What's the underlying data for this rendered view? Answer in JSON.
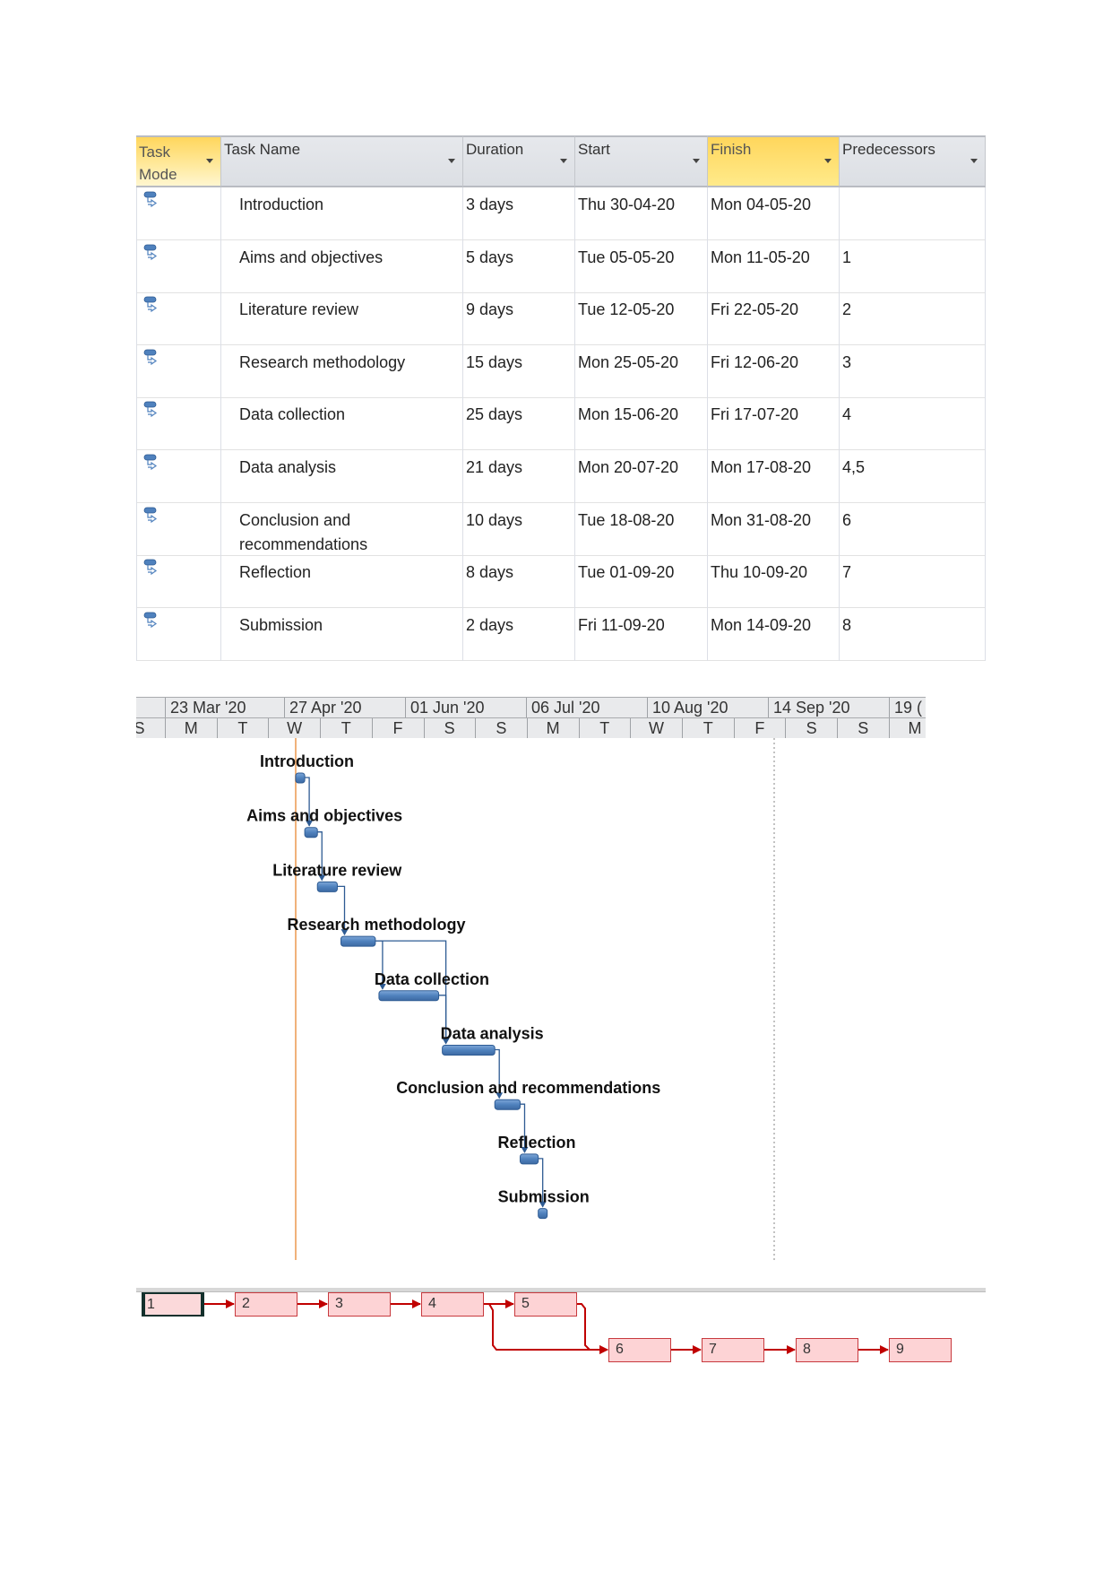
{
  "table": {
    "columns": [
      {
        "key": "mode",
        "label": "Task Mode",
        "highlighted": true
      },
      {
        "key": "name",
        "label": "Task Name",
        "highlighted": false
      },
      {
        "key": "duration",
        "label": "Duration",
        "highlighted": false
      },
      {
        "key": "start",
        "label": "Start",
        "highlighted": false
      },
      {
        "key": "finish",
        "label": "Finish",
        "highlighted": true
      },
      {
        "key": "predecessors",
        "label": "Predecessors",
        "highlighted": false
      }
    ],
    "mode_icon": "auto-scheduled-task-icon",
    "rows": [
      {
        "id": 1,
        "name": "Introduction",
        "duration": "3 days",
        "start": "Thu 30-04-20",
        "finish": "Mon 04-05-20",
        "predecessors": ""
      },
      {
        "id": 2,
        "name": "Aims and objectives",
        "duration": "5 days",
        "start": "Tue 05-05-20",
        "finish": "Mon 11-05-20",
        "predecessors": "1"
      },
      {
        "id": 3,
        "name": "Literature review",
        "duration": "9 days",
        "start": "Tue 12-05-20",
        "finish": "Fri 22-05-20",
        "predecessors": "2"
      },
      {
        "id": 4,
        "name": "Research methodology",
        "duration": "15 days",
        "start": "Mon 25-05-20",
        "finish": "Fri 12-06-20",
        "predecessors": "3"
      },
      {
        "id": 5,
        "name": "Data collection",
        "duration": "25 days",
        "start": "Mon 15-06-20",
        "finish": "Fri 17-07-20",
        "predecessors": "4"
      },
      {
        "id": 6,
        "name": "Data analysis",
        "duration": "21 days",
        "start": "Mon 20-07-20",
        "finish": "Mon 17-08-20",
        "predecessors": "4,5"
      },
      {
        "id": 7,
        "name": "Conclusion and recommendations",
        "name_lines": [
          "Conclusion and",
          "recommendations"
        ],
        "duration": "10 days",
        "start": "Tue 18-08-20",
        "finish": "Mon 31-08-20",
        "predecessors": "6"
      },
      {
        "id": 8,
        "name": "Reflection",
        "duration": "8 days",
        "start": "Tue 01-09-20",
        "finish": "Thu 10-09-20",
        "predecessors": "7"
      },
      {
        "id": 9,
        "name": "Submission",
        "duration": "2 days",
        "start": "Fri 11-09-20",
        "finish": "Mon 14-09-20",
        "predecessors": "8"
      }
    ]
  },
  "gantt": {
    "timescale_top": [
      "",
      "23 Mar '20",
      "27 Apr '20",
      "01 Jun '20",
      "06 Jul '20",
      "10 Aug '20",
      "14 Sep '20",
      "19 ("
    ],
    "timescale_bottom": [
      "S",
      "M",
      "T",
      "W",
      "T",
      "F",
      "S",
      "S",
      "M",
      "T",
      "W",
      "T",
      "F",
      "S",
      "S",
      "M"
    ],
    "bar_color": "#4f81bd",
    "today_line_color": "#f0b27a",
    "bars": [
      {
        "id": 1,
        "label": "Introduction"
      },
      {
        "id": 2,
        "label": "Aims and objectives"
      },
      {
        "id": 3,
        "label": "Literature review"
      },
      {
        "id": 4,
        "label": "Research methodology"
      },
      {
        "id": 5,
        "label": "Data collection"
      },
      {
        "id": 6,
        "label": "Data analysis"
      },
      {
        "id": 7,
        "label": "Conclusion and recommendations"
      },
      {
        "id": 8,
        "label": "Reflection"
      },
      {
        "id": 9,
        "label": "Submission"
      }
    ]
  },
  "network": {
    "node_fill": "#fdd3d5",
    "node_border": "#c83a3e",
    "link_color": "#c00000",
    "selected": "1",
    "nodes": [
      {
        "id": "1"
      },
      {
        "id": "2"
      },
      {
        "id": "3"
      },
      {
        "id": "4"
      },
      {
        "id": "5"
      },
      {
        "id": "6"
      },
      {
        "id": "7"
      },
      {
        "id": "8"
      },
      {
        "id": "9"
      }
    ],
    "links": [
      [
        "1",
        "2"
      ],
      [
        "2",
        "3"
      ],
      [
        "3",
        "4"
      ],
      [
        "4",
        "5"
      ],
      [
        "4",
        "6"
      ],
      [
        "5",
        "6"
      ],
      [
        "6",
        "7"
      ],
      [
        "7",
        "8"
      ],
      [
        "8",
        "9"
      ]
    ]
  }
}
